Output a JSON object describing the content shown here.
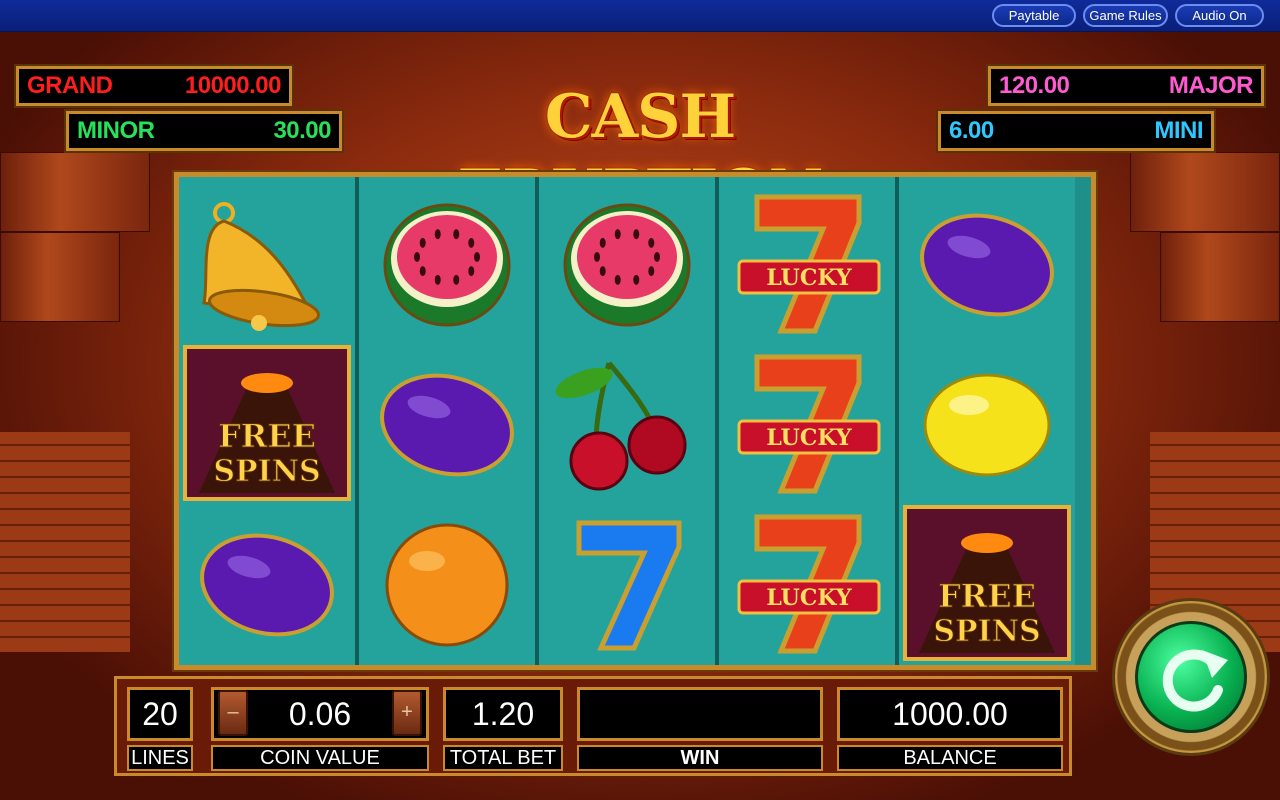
{
  "topbar": {
    "buttons": [
      {
        "label": "Paytable"
      },
      {
        "label": "Game Rules"
      },
      {
        "label": "Audio On"
      }
    ]
  },
  "game": {
    "title": "CASH ERUPTION"
  },
  "jackpots": {
    "grand": {
      "label": "GRAND",
      "value": "10000.00",
      "color": "#ff1e1e"
    },
    "minor": {
      "label": "MINOR",
      "value": "30.00",
      "color": "#28e05a"
    },
    "major": {
      "label": "MAJOR",
      "value": "120.00",
      "color": "#ff5ad2"
    },
    "mini": {
      "label": "MINI",
      "value": "6.00",
      "color": "#2ec8ff"
    }
  },
  "reels": [
    [
      "bell-icon",
      "free-spins-icon",
      "plum-icon"
    ],
    [
      "watermelon-icon",
      "plum-icon",
      "orange-icon"
    ],
    [
      "watermelon-icon",
      "cherries-icon",
      "blue-seven-icon"
    ],
    [
      "lucky-seven-icon",
      "lucky-seven-icon",
      "lucky-seven-icon"
    ],
    [
      "plum-icon",
      "lemon-icon",
      "free-spins-icon"
    ]
  ],
  "symbols": {
    "lucky_text": "LUCKY",
    "free_spins_line1": "FREE",
    "free_spins_line2": "SPINS"
  },
  "panel": {
    "lines": {
      "value": "20",
      "label": "LINES"
    },
    "coin_value": {
      "value": "0.06",
      "label": "COIN VALUE",
      "minus": "–",
      "plus": "+"
    },
    "total_bet": {
      "value": "1.20",
      "label": "TOTAL BET"
    },
    "win": {
      "value": "",
      "label": "WIN"
    },
    "balance": {
      "value": "1000.00",
      "label": "BALANCE"
    }
  },
  "colors": {
    "gold": "#c98a2a",
    "reel_bg": "#23a39b",
    "spin_green": "#08b050"
  }
}
